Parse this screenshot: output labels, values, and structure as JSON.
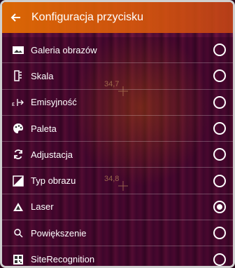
{
  "header": {
    "title": "Konfiguracja przycisku",
    "back_icon": "arrow-left-icon"
  },
  "items": [
    {
      "label": "Galeria obrazów",
      "icon": "gallery-icon",
      "selected": false
    },
    {
      "label": "Skala",
      "icon": "scale-icon",
      "selected": false
    },
    {
      "label": "Emisyjność",
      "icon": "emissivity-icon",
      "selected": false
    },
    {
      "label": "Paleta",
      "icon": "palette-icon",
      "selected": false
    },
    {
      "label": "Adjustacja",
      "icon": "refresh-icon",
      "selected": false
    },
    {
      "label": "Typ obrazu",
      "icon": "image-type-icon",
      "selected": false
    },
    {
      "label": "Laser",
      "icon": "laser-icon",
      "selected": true
    },
    {
      "label": "Powiększenie",
      "icon": "magnifier-icon",
      "selected": false
    },
    {
      "label": "SiteRecognition",
      "icon": "qr-code-icon",
      "selected": false
    }
  ],
  "readouts": {
    "top": "34,7",
    "middle": "34,8"
  },
  "colors": {
    "header": "#e36a00",
    "text": "#ffffff"
  }
}
